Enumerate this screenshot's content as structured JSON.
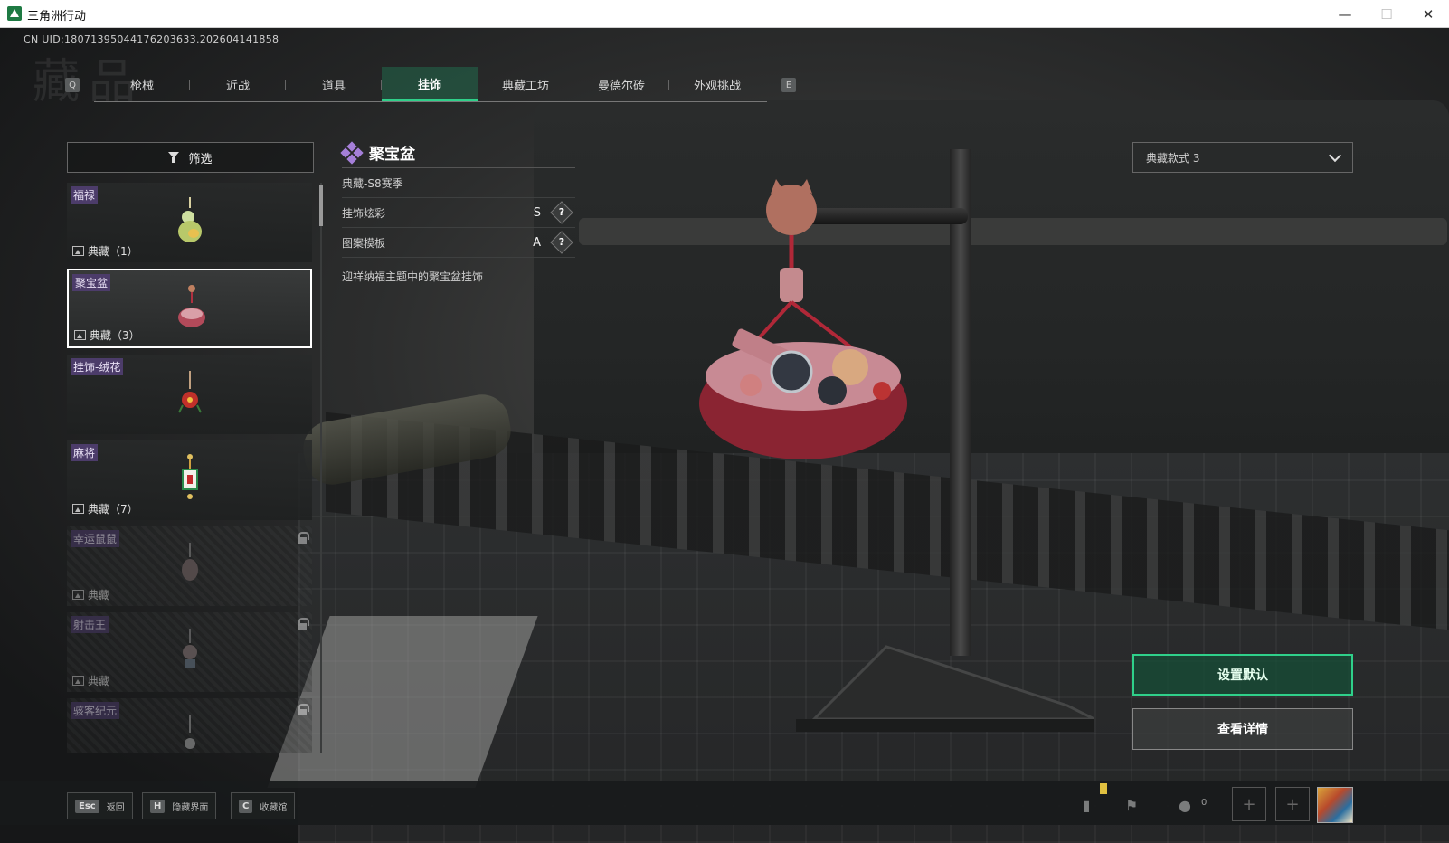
{
  "window": {
    "title": "三角洲行动"
  },
  "header": {
    "uid": "CN UID:18071395044176203633.202604141858",
    "page_watermark": "藏品"
  },
  "tabs": {
    "left_key": "Q",
    "right_key": "E",
    "items": [
      {
        "label": "枪械",
        "active": false
      },
      {
        "label": "近战",
        "active": false
      },
      {
        "label": "道具",
        "active": false
      },
      {
        "label": "挂饰",
        "active": true
      },
      {
        "label": "典藏工坊",
        "active": false
      },
      {
        "label": "曼德尔砖",
        "active": false
      },
      {
        "label": "外观挑战",
        "active": false
      }
    ]
  },
  "filter": {
    "label": "筛选"
  },
  "list": [
    {
      "tag": "福禄",
      "sub": "典藏（1）",
      "locked": false,
      "selected": false
    },
    {
      "tag": "聚宝盆",
      "sub": "典藏（3）",
      "locked": false,
      "selected": true
    },
    {
      "tag": "挂饰-绒花",
      "sub": "",
      "locked": false,
      "selected": false
    },
    {
      "tag": "麻将",
      "sub": "典藏（7）",
      "locked": false,
      "selected": false
    },
    {
      "tag": "幸运鼠鼠",
      "sub": "典藏",
      "locked": true,
      "selected": false
    },
    {
      "tag": "射击王",
      "sub": "典藏",
      "locked": true,
      "selected": false
    },
    {
      "tag": "骇客纪元",
      "sub": "",
      "locked": true,
      "selected": false
    }
  ],
  "detail": {
    "name": "聚宝盆",
    "season": "典藏-S8赛季",
    "attributes": [
      {
        "label": "挂饰炫彩",
        "grade": "S",
        "help": "?"
      },
      {
        "label": "图案模板",
        "grade": "A",
        "help": "?"
      }
    ],
    "description": "迎祥纳福主题中的聚宝盆挂饰"
  },
  "style_select": {
    "value": "典藏款式 3"
  },
  "actions": {
    "set_default": "设置默认",
    "view_details": "查看详情"
  },
  "bottom_hints": [
    {
      "key": "Esc",
      "label": "返回"
    },
    {
      "key": "H",
      "label": "隐藏界面"
    },
    {
      "key": "C",
      "label": "收藏馆"
    }
  ],
  "bottom_right": {
    "friends_count": "0"
  },
  "colors": {
    "accent": "#2fd08a",
    "tag_bg": "#4c3c6a",
    "rarity": "#a57fd9"
  }
}
